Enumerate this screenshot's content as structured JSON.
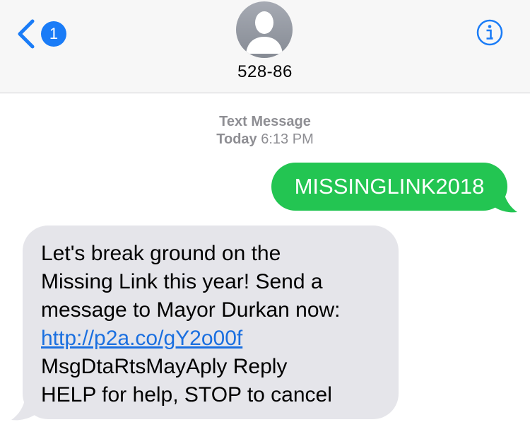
{
  "header": {
    "back_badge_count": "1",
    "contact_name": "528-86"
  },
  "conversation": {
    "timestamp_label": "Text Message",
    "timestamp_day": "Today",
    "timestamp_time": "6:13 PM",
    "messages": [
      {
        "direction": "sent",
        "text": "MISSINGLINK2018"
      },
      {
        "direction": "received",
        "lines": [
          "Let's break ground on the",
          "Missing Link this year! Send a",
          "message to Mayor Durkan now:"
        ],
        "link": "http://p2a.co/gY2o00f",
        "after_lines": [
          "MsgDtaRtsMayAply Reply",
          "HELP for help, STOP to cancel"
        ]
      }
    ]
  },
  "colors": {
    "sent_bubble": "#23c552",
    "received_bubble": "#e5e5ea",
    "accent_blue": "#1a7cf7",
    "timestamp_gray": "#8e8e93"
  },
  "icons": {
    "back": "chevron-left-icon",
    "avatar": "person-silhouette-icon",
    "info": "info-circle-icon"
  }
}
